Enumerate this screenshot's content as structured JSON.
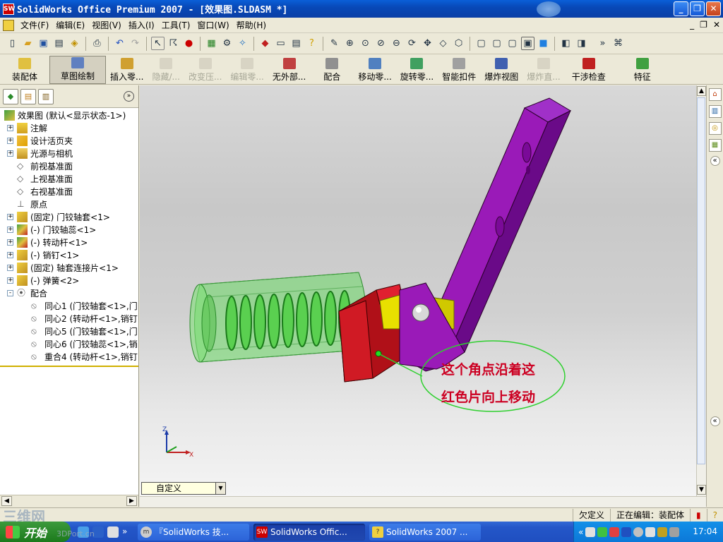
{
  "window": {
    "title": "SolidWorks Office Premium 2007 - [效果图.SLDASM *]",
    "app_icon_text": "SW"
  },
  "menu": [
    "文件(F)",
    "编辑(E)",
    "视图(V)",
    "插入(I)",
    "工具(T)",
    "窗口(W)",
    "帮助(H)"
  ],
  "command_manager": {
    "items": [
      {
        "label": "装配体",
        "state": "normal"
      },
      {
        "label": "草图绘制",
        "state": "active"
      },
      {
        "label": "插入零...",
        "state": "normal"
      },
      {
        "label": "隐藏/...",
        "state": "disabled"
      },
      {
        "label": "改变压...",
        "state": "disabled"
      },
      {
        "label": "编辑零...",
        "state": "disabled"
      },
      {
        "label": "无外部...",
        "state": "normal"
      },
      {
        "label": "配合",
        "state": "normal"
      },
      {
        "label": "移动零...",
        "state": "normal"
      },
      {
        "label": "旋转零...",
        "state": "normal"
      },
      {
        "label": "智能扣件",
        "state": "normal"
      },
      {
        "label": "爆炸视图",
        "state": "normal"
      },
      {
        "label": "爆炸直...",
        "state": "disabled"
      },
      {
        "label": "干涉检查",
        "state": "normal"
      },
      {
        "label": "特征",
        "state": "normal"
      }
    ]
  },
  "feature_tree": {
    "root": "效果图  (默认<显示状态-1>)",
    "items": [
      {
        "label": "注解",
        "expander": "+",
        "icon": "annotation-icon"
      },
      {
        "label": "设计活页夹",
        "expander": "+",
        "icon": "design-binder-icon"
      },
      {
        "label": "光源与相机",
        "expander": "+",
        "icon": "lights-cameras-icon"
      },
      {
        "label": "前视基准面",
        "expander": "",
        "icon": "plane-icon"
      },
      {
        "label": "上视基准面",
        "expander": "",
        "icon": "plane-icon"
      },
      {
        "label": "右视基准面",
        "expander": "",
        "icon": "plane-icon"
      },
      {
        "label": "原点",
        "expander": "",
        "icon": "origin-icon"
      },
      {
        "label": "(固定) 门铰轴套<1>",
        "expander": "+",
        "icon": "part-icon"
      },
      {
        "label": "(-) 门铰轴蕊<1>",
        "expander": "+",
        "icon": "subassembly-icon"
      },
      {
        "label": "(-) 转动杆<1>",
        "expander": "+",
        "icon": "subassembly-icon"
      },
      {
        "label": "(-) 销钉<1>",
        "expander": "+",
        "icon": "part-icon"
      },
      {
        "label": "(固定) 轴套连接片<1>",
        "expander": "+",
        "icon": "part-icon"
      },
      {
        "label": "(-) 弹簧<2>",
        "expander": "+",
        "icon": "part-icon"
      },
      {
        "label": "配合",
        "expander": "-",
        "icon": "mates-icon"
      }
    ],
    "mates": [
      {
        "label": "同心1 (门铰轴套<1>,门"
      },
      {
        "label": "同心2 (转动杆<1>,销钉"
      },
      {
        "label": "同心5 (门铰轴套<1>,门"
      },
      {
        "label": "同心6 (门铰轴蕊<1>,销"
      },
      {
        "label": "重合4 (转动杆<1>,销钉"
      }
    ]
  },
  "annotation": {
    "line1": "这个角点沿着这",
    "line2": "红色片向上移动"
  },
  "triad": {
    "z": "Z",
    "x": "X"
  },
  "view_select": "自定义",
  "status": {
    "underdefined": "欠定义",
    "editing": "正在编辑：装配体",
    "help_icon": "?"
  },
  "taskbar": {
    "start": "开始",
    "tasks": [
      {
        "label": "『SolidWorks 技...",
        "active": false
      },
      {
        "label": "SolidWorks Offic...",
        "active": true
      },
      {
        "label": "SolidWorks 2007 ...",
        "active": false
      }
    ],
    "clock": "17:04"
  },
  "watermark": {
    "logo": "三维网",
    "url": "3DPort.cn"
  },
  "colors": {
    "rod": "#8a0aa8",
    "sleeve": "#6ad864",
    "bracket": "#b40e1a",
    "pin_block": "#e8e000",
    "annotation": "#cc0022"
  }
}
